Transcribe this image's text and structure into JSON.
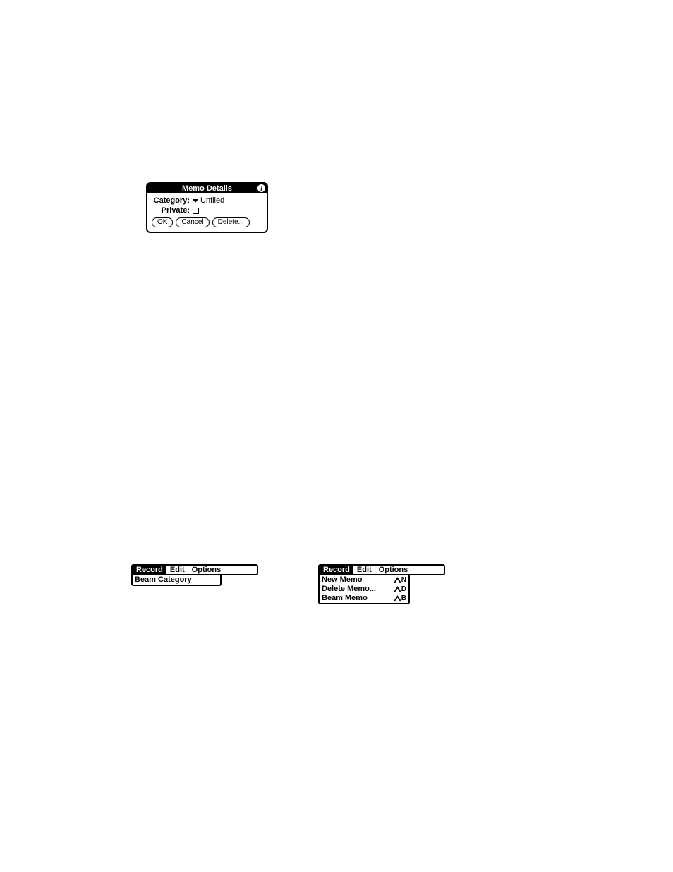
{
  "memo_details": {
    "title": "Memo Details",
    "category_label": "Category:",
    "category_value": "Unfiled",
    "private_label": "Private:",
    "private_checked": false,
    "buttons": {
      "ok": "OK",
      "cancel": "Cancel",
      "delete": "Delete..."
    }
  },
  "menubar": {
    "record": "Record",
    "edit": "Edit",
    "options": "Options"
  },
  "left_menu": {
    "items": [
      {
        "label": "Beam Category",
        "shortcut": ""
      }
    ]
  },
  "right_menu": {
    "items": [
      {
        "label": "New Memo",
        "shortcut": "N"
      },
      {
        "label": "Delete Memo...",
        "shortcut": "D"
      },
      {
        "label": "Beam Memo",
        "shortcut": "B"
      }
    ]
  }
}
